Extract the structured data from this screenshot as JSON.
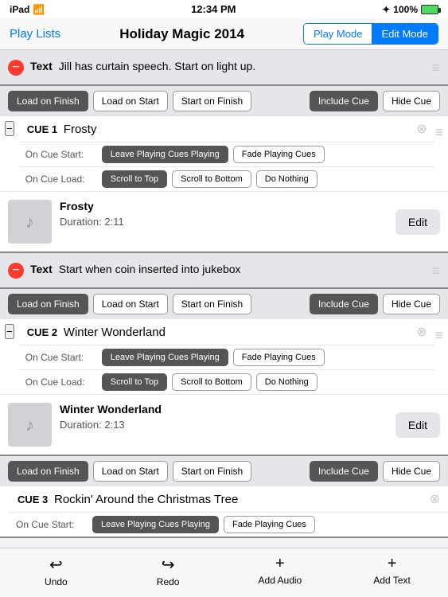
{
  "statusBar": {
    "left": "iPad",
    "time": "12:34 PM",
    "bluetooth": "⌀",
    "battery": "100%"
  },
  "navBar": {
    "backLabel": "Play Lists",
    "title": "Holiday Magic 2014",
    "playModeLabel": "Play Mode",
    "editModeLabel": "Edit Mode"
  },
  "textBlock1": {
    "text": "Jill has curtain speech. Start on light up."
  },
  "cue1": {
    "label": "CUE 1",
    "name": "Frosty",
    "loadOnFinish": "Load on Finish",
    "loadOnStart": "Load on Start",
    "startOnFinish": "Start on Finish",
    "includeCue": "Include Cue",
    "hideCue": "Hide Cue",
    "onCueStartLabel": "On Cue Start:",
    "leavePlaying1": "Leave Playing Cues Playing",
    "fadePlaying1": "Fade Playing Cues",
    "onCueLoadLabel": "On Cue Load:",
    "scrollTop1": "Scroll to Top",
    "scrollBottom1": "Scroll to Bottom",
    "doNothing1": "Do Nothing",
    "songName": "Frosty",
    "duration": "Duration: 2:11",
    "editLabel": "Edit",
    "activeOnStart": "Leave Playing Cues Playing",
    "activeOnLoad": "Scroll to Top"
  },
  "textBlock2": {
    "text": "Start when coin inserted into jukebox"
  },
  "cue2": {
    "label": "CUE 2",
    "name": "Winter Wonderland",
    "loadOnFinish": "Load on Finish",
    "loadOnStart": "Load on Start",
    "startOnFinish": "Start on Finish",
    "includeCue": "Include Cue",
    "hideCue": "Hide Cue",
    "onCueStartLabel": "On Cue Start:",
    "leavePlaying": "Leave Playing Cues Playing",
    "fadePlaying": "Fade Playing Cues",
    "onCueLoadLabel": "On Cue Load:",
    "scrollTop": "Scroll to Top",
    "scrollBottom": "Scroll to Bottom",
    "doNothing": "Do Nothing",
    "songName": "Winter Wonderland",
    "duration": "Duration: 2:13",
    "editLabel": "Edit",
    "activeOnStart": "Leave Playing Cues Playing",
    "activeOnLoad": "Scroll to Top"
  },
  "cue3": {
    "label": "CUE 3",
    "name": "Rockin' Around the Christmas Tree",
    "loadOnFinish": "Load on Finish",
    "loadOnStart": "Load on Start",
    "startOnFinish": "Start on Finish",
    "includeCue": "Include Cue",
    "hideCue": "Hide Cue",
    "onCueStartLabel": "On Cue Start:",
    "leavePlaying": "Leave Playing Cues Playing",
    "fadePlaying": "Fade Playing Cues"
  },
  "toolbar": {
    "undoLabel": "Undo",
    "redoLabel": "Redo",
    "addAudioLabel": "Add Audio",
    "addTextLabel": "Add Text"
  }
}
